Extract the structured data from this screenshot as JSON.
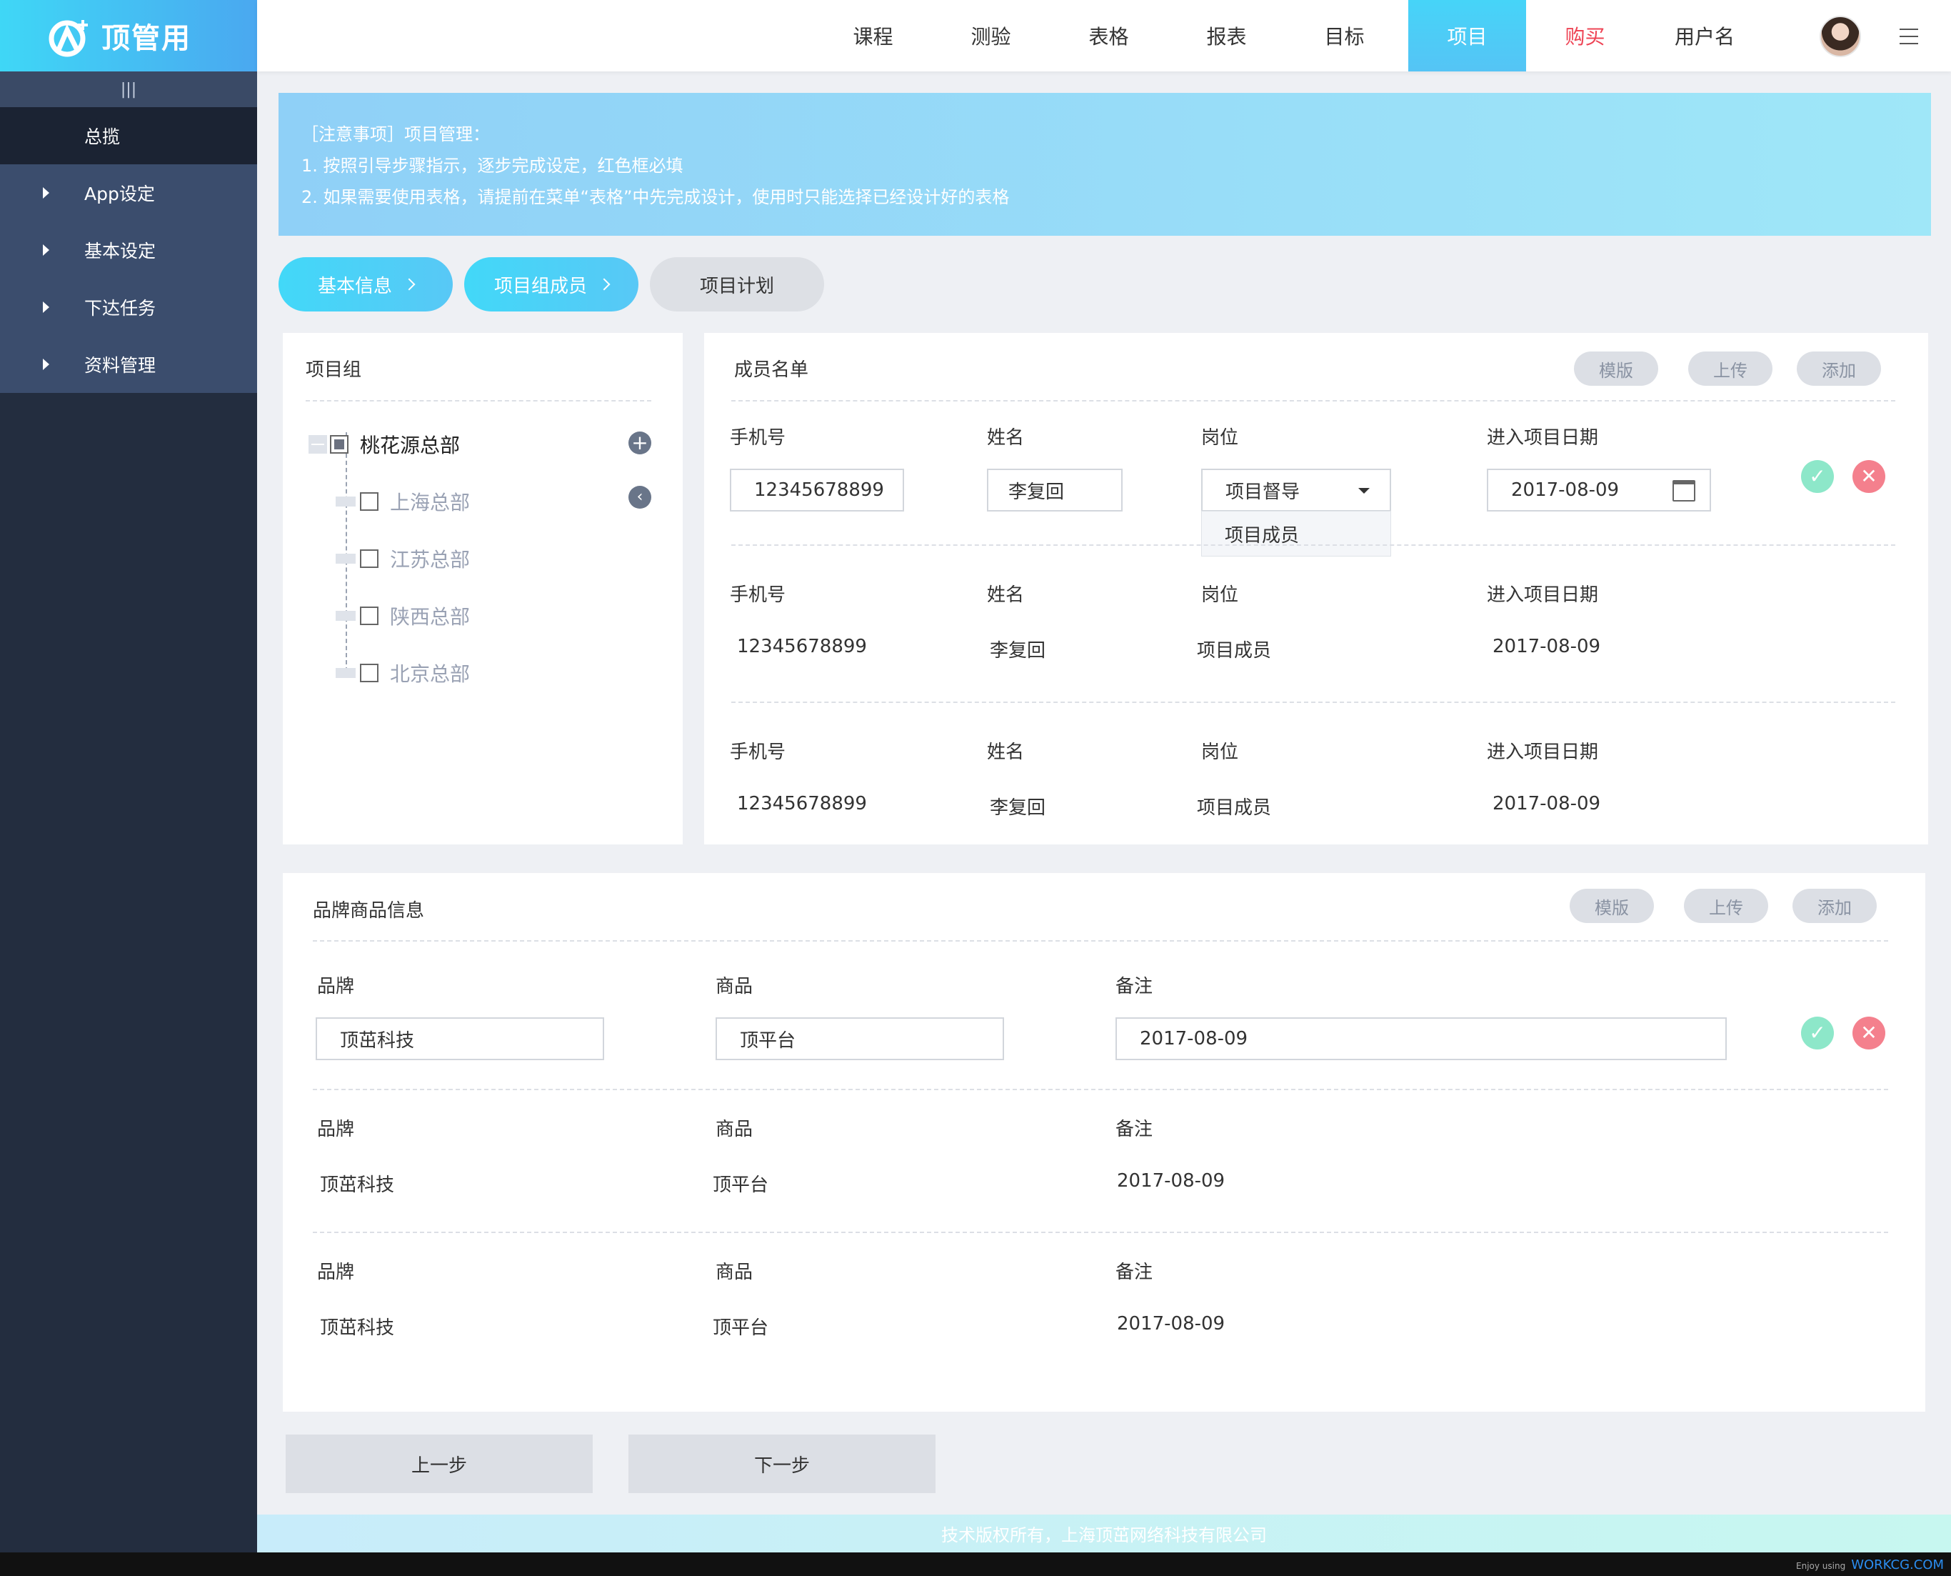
{
  "sidebar": {
    "logo_text": "顶管用",
    "collapse_glyph": "|||",
    "items": [
      {
        "label": "总揽"
      },
      {
        "label": "App设定"
      },
      {
        "label": "基本设定"
      },
      {
        "label": "下达任务"
      },
      {
        "label": "资料管理"
      }
    ]
  },
  "topnav": {
    "items": [
      {
        "label": "课程"
      },
      {
        "label": "测验"
      },
      {
        "label": "表格"
      },
      {
        "label": "报表"
      },
      {
        "label": "目标"
      },
      {
        "label": "项目",
        "active": true
      },
      {
        "label": "购买",
        "color": "#ee4455"
      }
    ],
    "username": "用户名",
    "menu_icon": "hamburger-icon"
  },
  "notice": {
    "line1": "［注意事项］项目管理：",
    "line2": "1. 按照引导步骤指示，逐步完成设定，红色框必填",
    "line3": "2. 如果需要使用表格，请提前在菜单“表格”中先完成设计，使用时只能选择已经设计好的表格"
  },
  "steps": [
    {
      "label": "基本信息",
      "state": "done"
    },
    {
      "label": "项目组成员",
      "state": "done"
    },
    {
      "label": "项目计划",
      "state": "todo"
    }
  ],
  "project_group": {
    "title": "项目组",
    "root": "桃花源总部",
    "children": [
      "上海总部",
      "江苏总部",
      "陕西总部",
      "北京总部"
    ]
  },
  "members": {
    "title": "成员名单",
    "buttons": {
      "template": "模版",
      "upload": "上传",
      "add": "添加"
    },
    "headers": {
      "phone": "手机号",
      "name": "姓名",
      "position": "岗位",
      "date": "进入项目日期"
    },
    "edit_row": {
      "phone": "12345678899",
      "name": "李复回",
      "position": "项目督导",
      "date": "2017-08-09"
    },
    "dropdown_option": "项目成员",
    "rows": [
      {
        "phone": "12345678899",
        "name": "李复回",
        "position": "项目成员",
        "date": "2017-08-09"
      },
      {
        "phone": "12345678899",
        "name": "李复回",
        "position": "项目成员",
        "date": "2017-08-09"
      }
    ]
  },
  "brand": {
    "title": "品牌商品信息",
    "buttons": {
      "template": "模版",
      "upload": "上传",
      "add": "添加"
    },
    "headers": {
      "brand": "品牌",
      "product": "商品",
      "note": "备注"
    },
    "edit_row": {
      "brand": "顶茁科技",
      "product": "顶平台",
      "note": "2017-08-09"
    },
    "rows": [
      {
        "brand": "顶茁科技",
        "product": "顶平台",
        "note": "2017-08-09"
      },
      {
        "brand": "顶茁科技",
        "product": "顶平台",
        "note": "2017-08-09"
      }
    ]
  },
  "actions": {
    "prev": "上一步",
    "next": "下一步"
  },
  "footer": {
    "text": "技术版权所有，上海顶茁网络科技有限公司"
  },
  "watermark": {
    "small": "Enjoy using",
    "brand": "WORKCG.COM"
  },
  "colors": {
    "accent": "#46d4f8",
    "sidebar": "#232d3f",
    "buy": "#ee4455",
    "ok": "#8de7c9",
    "cancel": "#f4808d"
  }
}
